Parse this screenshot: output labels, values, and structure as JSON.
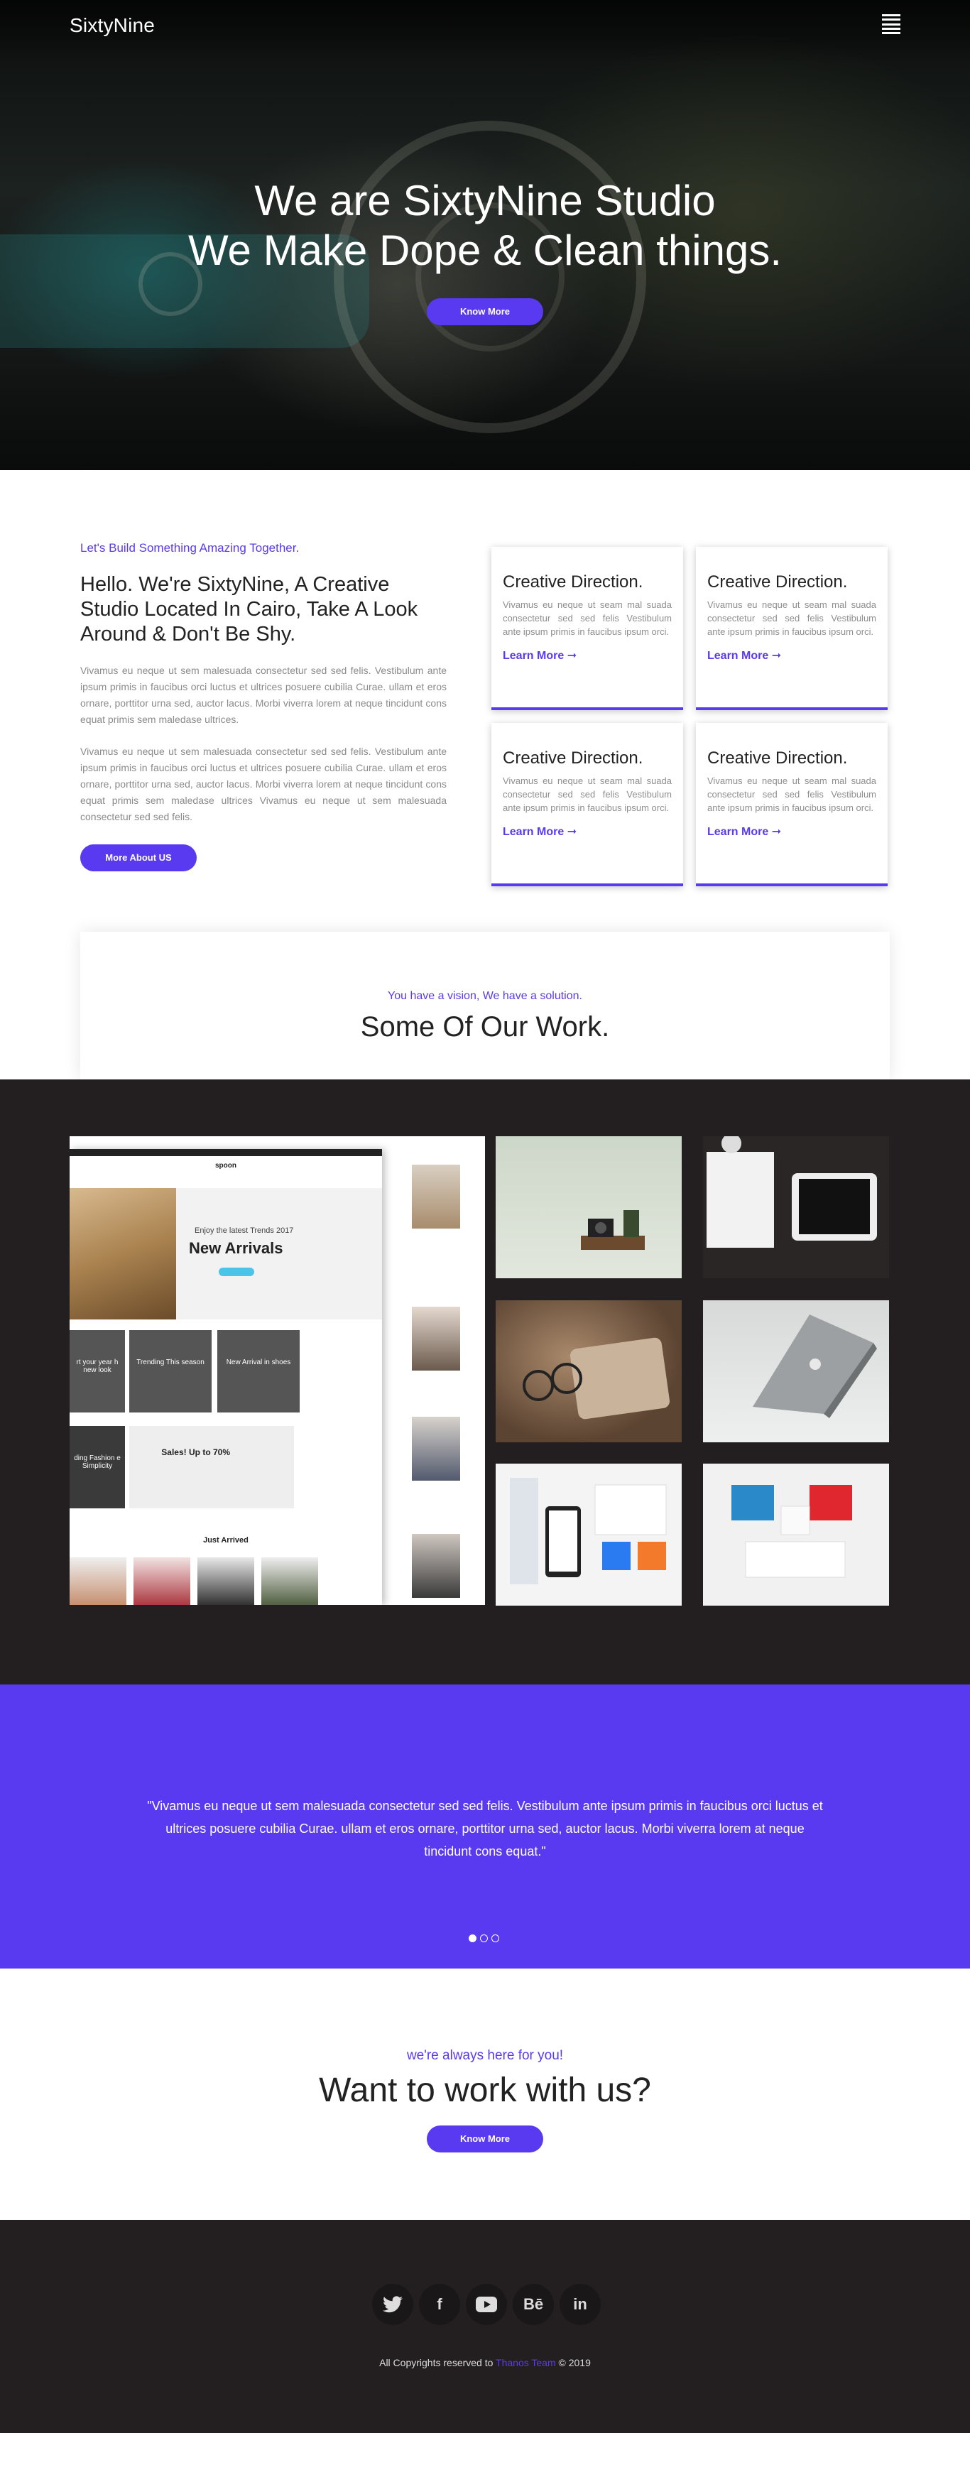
{
  "nav": {
    "brand": "SixtyNine",
    "menu_icon": "hamburger-menu-icon"
  },
  "hero": {
    "line1": "We are SixtyNine Studio",
    "line2": "We Make Dope & Clean things.",
    "button": "Know More"
  },
  "about": {
    "tagline": "Let's Build Something Amazing Together.",
    "title": "Hello. We're SixtyNine, A Creative Studio Located In Cairo, Take A Look Around & Don't Be Shy.",
    "p1": "Vivamus eu neque ut sem malesuada consectetur sed sed felis. Vestibulum ante ipsum primis in faucibus orci luctus et ultrices posuere cubilia Curae. ullam et eros ornare, porttitor urna sed, auctor lacus. Morbi viverra lorem at neque tincidunt cons equat primis sem maledase ultrices.",
    "p2": "Vivamus eu neque ut sem malesuada consectetur sed sed felis. Vestibulum ante ipsum primis in faucibus orci luctus et ultrices posuere cubilia Curae. ullam et eros ornare, porttitor urna sed, auctor lacus. Morbi viverra lorem at neque tincidunt cons equat primis sem maledase ultrices Vivamus eu neque ut sem malesuada consectetur sed sed felis.",
    "button": "More About US"
  },
  "services": [
    {
      "title": "Creative Direction.",
      "text": "Vivamus eu neque ut seam mal suada consectetur sed sed felis Vestibulum ante ipsum primis in faucibus ipsum orci.",
      "link": "Learn More ➞"
    },
    {
      "title": "Creative Direction.",
      "text": "Vivamus eu neque ut seam mal suada consectetur sed sed felis Vestibulum ante ipsum primis in faucibus ipsum orci.",
      "link": "Learn More ➞"
    },
    {
      "title": "Creative Direction.",
      "text": "Vivamus eu neque ut seam mal suada consectetur sed sed felis Vestibulum ante ipsum primis in faucibus ipsum orci.",
      "link": "Learn More ➞"
    },
    {
      "title": "Creative Direction.",
      "text": "Vivamus eu neque ut seam mal suada consectetur sed sed felis Vestibulum ante ipsum primis in faucibus ipsum orci.",
      "link": "Learn More ➞"
    }
  ],
  "work": {
    "subtitle": "You have a vision, We have a solution.",
    "title": "Some Of Our Work."
  },
  "mockup": {
    "logo": "spoon",
    "banner_small": "Enjoy the latest Trends 2017",
    "banner_big": "New Arrivals",
    "tile1": "rt your year h new look",
    "tile2": "Trending This season",
    "tile3": "New Arrival in shoes",
    "tile4": "ding Fashion e Simplicity",
    "sale": "Sales! Up to 70%",
    "just_arrived": "Just Arrived"
  },
  "testimonial": {
    "quote": "\"Vivamus eu neque ut sem malesuada consectetur sed sed felis. Vestibulum ante ipsum primis in faucibus orci luctus et ultrices posuere cubilia Curae. ullam et eros ornare, porttitor urna sed, auctor lacus. Morbi viverra lorem at neque tincidunt cons equat.\"",
    "slides": 3,
    "active_slide": 1
  },
  "cta": {
    "subtitle": "we're always here for you!",
    "title": "Want to work with us?",
    "button": "Know More"
  },
  "footer": {
    "socials": [
      {
        "icon": "twitter-icon",
        "glyph": "🐦"
      },
      {
        "icon": "facebook-icon",
        "glyph": "f"
      },
      {
        "icon": "youtube-icon",
        "glyph": "▶"
      },
      {
        "icon": "behance-icon",
        "glyph": "Bē"
      },
      {
        "icon": "linkedin-icon",
        "glyph": "in"
      }
    ],
    "copy_prefix": "All Copyrights reserved to ",
    "copy_link": "Thanos Team",
    "copy_suffix": " © 2019"
  },
  "colors": {
    "accent": "#5a3af0",
    "dark": "#231f20"
  }
}
